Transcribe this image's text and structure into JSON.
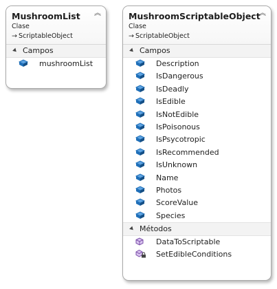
{
  "cards": [
    {
      "title": "MushroomList",
      "kind": "Clase",
      "base": "ScriptableObject",
      "sections": [
        {
          "title": "Campos",
          "items": [
            "mushroomList"
          ]
        }
      ]
    },
    {
      "title": "MushroomScriptableObject",
      "kind": "Clase",
      "base": "ScriptableObject",
      "sections": [
        {
          "title": "Campos",
          "items": [
            "Description",
            "IsDangerous",
            "IsDeadly",
            "IsEdible",
            "IsNotEdible",
            "IsPoisonous",
            "IsPsycotropic",
            "IsRecommended",
            "IsUnknown",
            "Name",
            "Photos",
            "ScoreValue",
            "Species"
          ]
        },
        {
          "title": "Métodos",
          "items": [
            "DataToScriptable",
            "SetEdibleConditions"
          ]
        }
      ]
    }
  ],
  "icons": {
    "field": "field-icon",
    "method": "method-icon",
    "private_method": "private-method-icon",
    "inherits": "inherits-arrow-icon",
    "collapse": "collapse-chevron-icon"
  },
  "colors": {
    "field_icon": "#1f6fb8",
    "method_icon": "#7a4ea8",
    "border": "#a9a9a9"
  }
}
